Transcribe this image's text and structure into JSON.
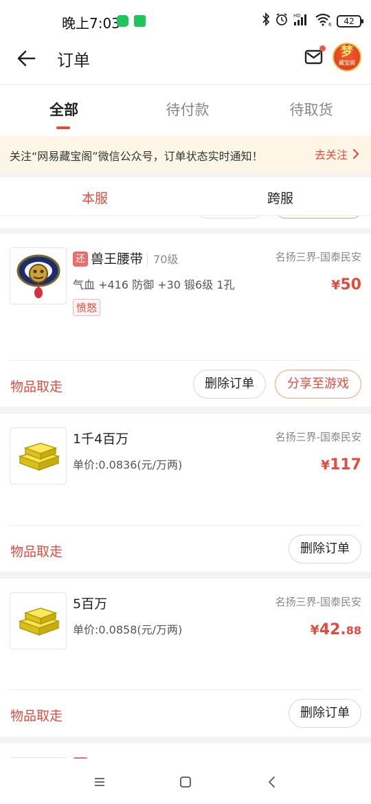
{
  "status_bar": {
    "time": "晚上7:03",
    "battery": "42",
    "hd_label": "HD",
    "wifi_sub": "6"
  },
  "header": {
    "title": "订单",
    "avatar_char": "梦",
    "avatar_sub": "藏宝阁"
  },
  "tabs": [
    {
      "label": "全部",
      "active": true
    },
    {
      "label": "待付款",
      "active": false
    },
    {
      "label": "待取货",
      "active": false
    }
  ],
  "notice": {
    "text": "关注“网易藏宝阁”微信公众号，订单状态实时通知！",
    "link": "去关注"
  },
  "server_tabs": [
    {
      "label": "本服",
      "active": true
    },
    {
      "label": "跨服",
      "active": false
    }
  ],
  "orders": [
    {
      "tag": "还",
      "name": "兽王腰带",
      "level": "70级",
      "server": "名扬三界-国泰民安",
      "desc": "气血 +416 防御 +30  锻6级  1孔",
      "label": "愤怒",
      "price_symbol": "¥",
      "price_int": "50",
      "price_dec": "",
      "status": "物品取走",
      "buttons": [
        "删除订单",
        "分享至游戏"
      ]
    },
    {
      "name": "1千4百万",
      "server": "名扬三界-国泰民安",
      "desc": "单价:0.0836(元/万两)",
      "price_symbol": "¥",
      "price_int": "117",
      "price_dec": "",
      "status": "物品取走",
      "buttons": [
        "删除订单"
      ]
    },
    {
      "name": "5百万",
      "server": "名扬三界-国泰民安",
      "desc": "单价:0.0858(元/万两)",
      "price_symbol": "¥",
      "price_int": "42.",
      "price_dec": "88",
      "status": "物品取走",
      "buttons": [
        "删除订单"
      ]
    }
  ],
  "colors": {
    "accent": "#e54b3d",
    "notice_bg": "#fdf6e6"
  },
  "icons": [
    "back-arrow-icon",
    "mail-icon",
    "chevron-right-icon",
    "menu-icon",
    "home-square-icon",
    "nav-back-icon"
  ]
}
